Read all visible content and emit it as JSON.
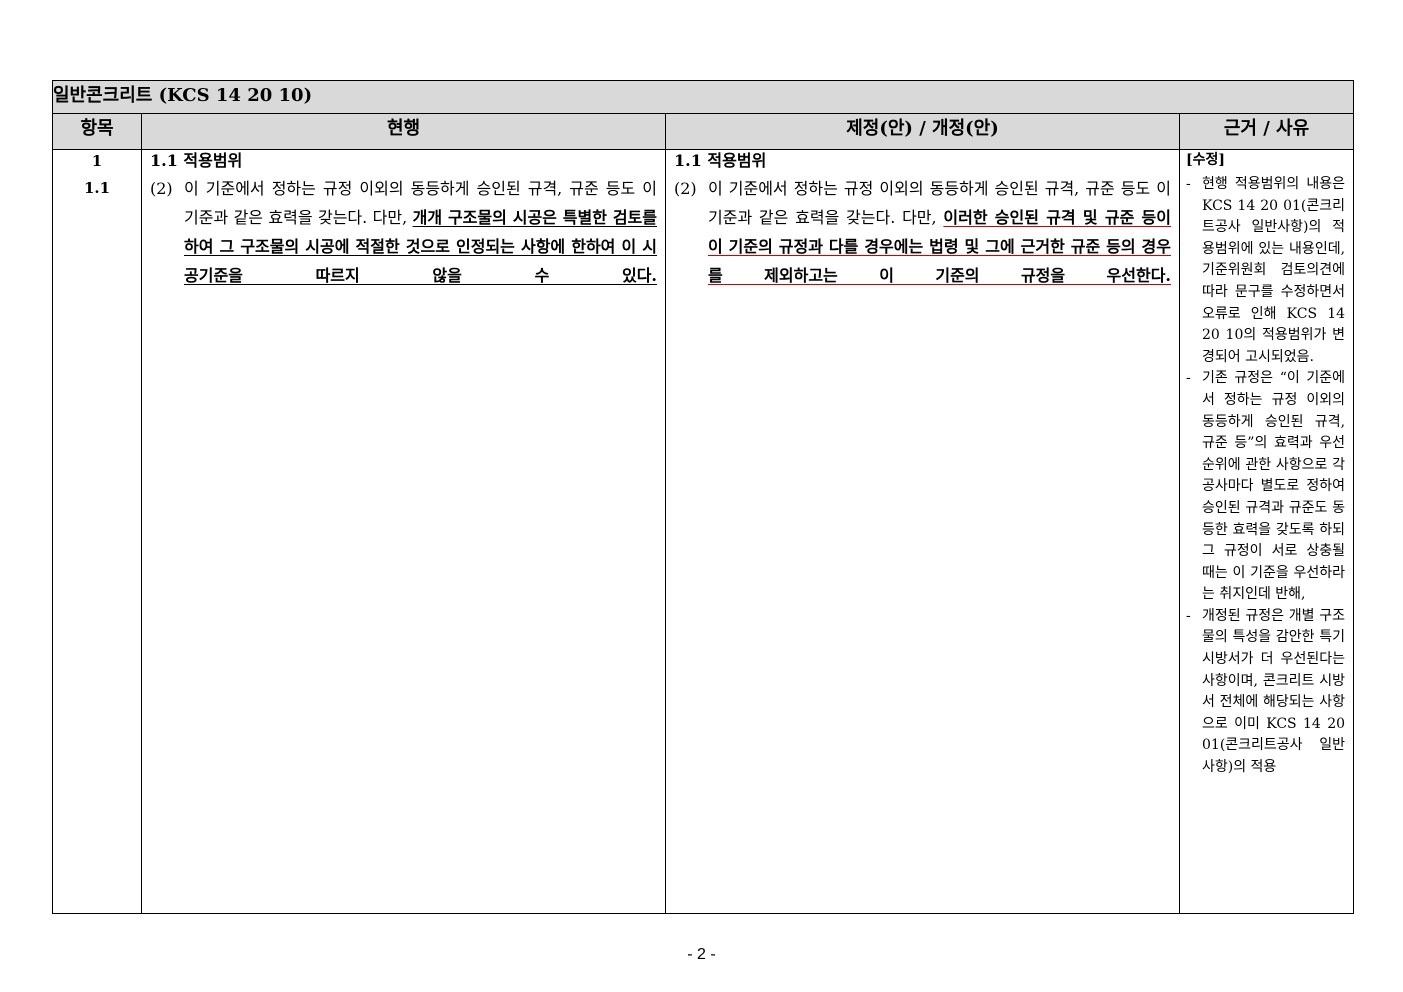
{
  "table": {
    "title": "일반콘크리트 (KCS 14 20 10)",
    "headers": [
      "항목",
      "현행",
      "제정(안) / 개정(안)",
      "근거 / 사유"
    ],
    "item": {
      "chapter": "1",
      "clause": "1.1"
    },
    "current": {
      "section": "1.1 적용범위",
      "para_num": "(2)",
      "plain": "이 기준에서 정하는 규정 이외의 동등하게 승인된 규격, 규준 등도 이 기준과 같은 효력을 갖는다. 다만, ",
      "underlined": "개개 구조물의 시공은 특별한 검토를 하여 그 구조물의 시공에 적절한 것으로 인정되는 사항에 한하여 이 시공기준을 따르지 않을 수 있다."
    },
    "proposed": {
      "section": "1.1 적용범위",
      "para_num": "(2)",
      "plain": "이 기준에서 정하는 규정 이외의 동등하게 승인된 규격, 규준 등도 이 기준과 같은 효력을 갖는다. 다만, ",
      "underlined": "이러한 승인된 규격 및 규준 등이 이 기준의 규정과 다를 경우에는 법령 및 그에 근거한 규준 등의 경우를 제외하고는 이 기준의 규정을 우선한다."
    },
    "reason": {
      "tag": "[수정]",
      "bullets": [
        "현행 적용범위의 내용은 KCS 14 20 01(콘크리트공사 일반사항)의 적용범위에 있는 내용인데, 기준위원회 검토의견에 따라 문구를 수정하면서 오류로 인해 KCS 14 20 10의 적용범위가 변경되어 고시되었음.",
        "기존 규정은 “이 기준에서 정하는 규정 이외의 동등하게 승인된 규격, 규준 등”의 효력과 우선순위에 관한 사항으로 각 공사마다 별도로 정하여 승인된 규격과 규준도 동등한 효력을 갖도록 하되 그 규정이 서로 상충될 때는 이 기준을 우선하라는 취지인데 반해,",
        "개정된 규정은 개별 구조물의 특성을 감안한 특기시방서가 더 우선된다는 사항이며, 콘크리트 시방서 전체에 해당되는 사항으로 이미 KCS 14 20 01(콘크리트공사 일반사항)의 적용"
      ]
    }
  },
  "page_number": "- 2 -"
}
